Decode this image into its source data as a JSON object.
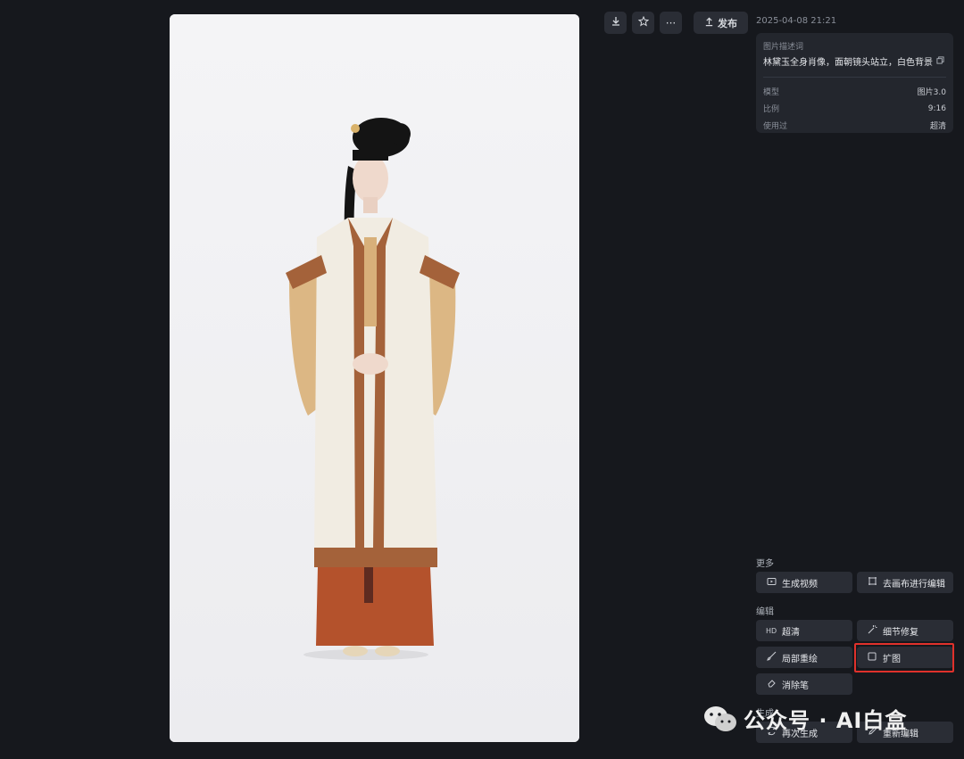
{
  "toolbar": {
    "download_icon": "download-icon",
    "star_icon": "star-icon",
    "more_label": "···",
    "publish_label": "发布"
  },
  "details": {
    "timestamp": "2025-04-08 21:21",
    "prompt_label": "图片描述词",
    "prompt_text": "林黛玉全身肖像，面朝镜头站立，白色背景",
    "meta": [
      {
        "key": "模型",
        "value": "图片3.0"
      },
      {
        "key": "比例",
        "value": "9:16"
      },
      {
        "key": "使用过",
        "value": "超清"
      }
    ]
  },
  "more": {
    "title": "更多",
    "generate_video": "生成视频",
    "canvas_edit": "去画布进行编辑"
  },
  "edit": {
    "title": "编辑",
    "hd_icon": "HD",
    "upscale": "超清",
    "detail_fix": "细节修复",
    "inpaint": "局部重绘",
    "outpaint": "扩图",
    "eraser": "消除笔"
  },
  "generate": {
    "title": "生成",
    "regenerate": "再次生成",
    "reedit": "重新编辑"
  },
  "watermark": {
    "text": "公众号 · AI白盒"
  },
  "colors": {
    "background": "#16181d",
    "panel": "#23262d",
    "button": "#2a2d35",
    "highlight": "#e0312b"
  }
}
